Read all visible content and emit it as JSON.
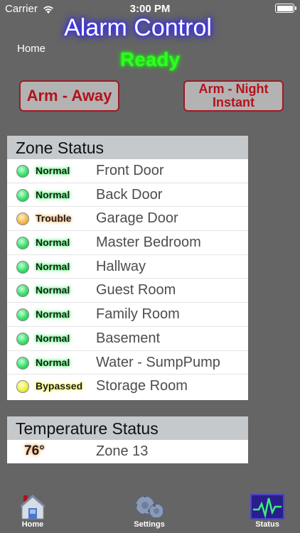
{
  "status_bar": {
    "carrier": "Carrier",
    "time": "3:00 PM"
  },
  "header": {
    "title": "Alarm Control",
    "home_link": "Home",
    "system_state": "Ready"
  },
  "actions": {
    "arm_away": "Arm - Away",
    "arm_night_line1": "Arm - Night",
    "arm_night_line2": "Instant"
  },
  "zone_status": {
    "title": "Zone Status",
    "zones": [
      {
        "status": "Normal",
        "name": "Front Door"
      },
      {
        "status": "Normal",
        "name": "Back Door"
      },
      {
        "status": "Trouble",
        "name": "Garage Door"
      },
      {
        "status": "Normal",
        "name": "Master Bedroom"
      },
      {
        "status": "Normal",
        "name": "Hallway"
      },
      {
        "status": "Normal",
        "name": "Guest Room"
      },
      {
        "status": "Normal",
        "name": "Family Room"
      },
      {
        "status": "Normal",
        "name": "Basement"
      },
      {
        "status": "Normal",
        "name": "Water - SumpPump"
      },
      {
        "status": "Bypassed",
        "name": "Storage Room"
      }
    ]
  },
  "temperature_status": {
    "title": "Temperature Status",
    "readings": [
      {
        "value": "76°",
        "zone": "Zone 13"
      }
    ]
  },
  "tabs": [
    {
      "label": "Home",
      "icon": "home-icon"
    },
    {
      "label": "Settings",
      "icon": "gears-icon"
    },
    {
      "label": "Status",
      "icon": "pulse-monitor-icon"
    }
  ],
  "colors": {
    "background": "#656565",
    "ready": "#2dff1e",
    "arm_text": "#b4121c",
    "normal": "#39e06a",
    "trouble": "#f3b94a",
    "bypassed": "#f0f040"
  }
}
